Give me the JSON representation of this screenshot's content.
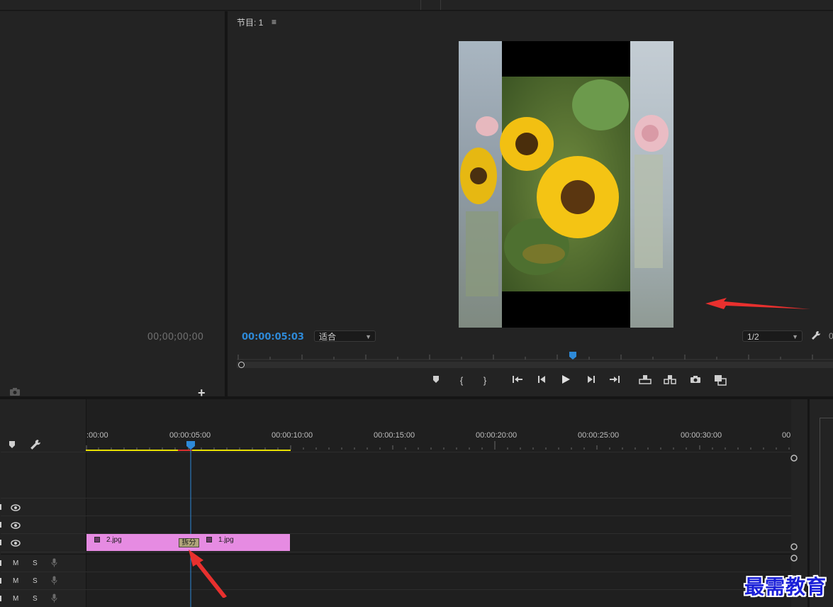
{
  "source": {
    "timecode": "00;00;00;00"
  },
  "program": {
    "title": "节目: 1",
    "menu_icon": "hamburger-menu-icon",
    "timecode": "00:00:05:03",
    "fit_label": "适合",
    "resolution_label": "1/2",
    "extra_value": "0"
  },
  "timeline": {
    "ruler_labels": [
      ":00:00",
      "00:00:05:00",
      "00:00:10:00",
      "00:00:15:00",
      "00:00:20:00",
      "00:00:25:00",
      "00:00:30:00",
      "00"
    ],
    "clips": [
      {
        "label": "2.jpg"
      },
      {
        "label": "1.jpg"
      }
    ],
    "split_label": "拆分",
    "audio_m": "M",
    "audio_s": "S"
  },
  "watermark": "最需教育",
  "colors": {
    "accent_blue": "#2e8ad8",
    "clip_pink": "#e68be2",
    "work_area_yellow": "#e8e000",
    "arrow_red": "#e8302e"
  }
}
